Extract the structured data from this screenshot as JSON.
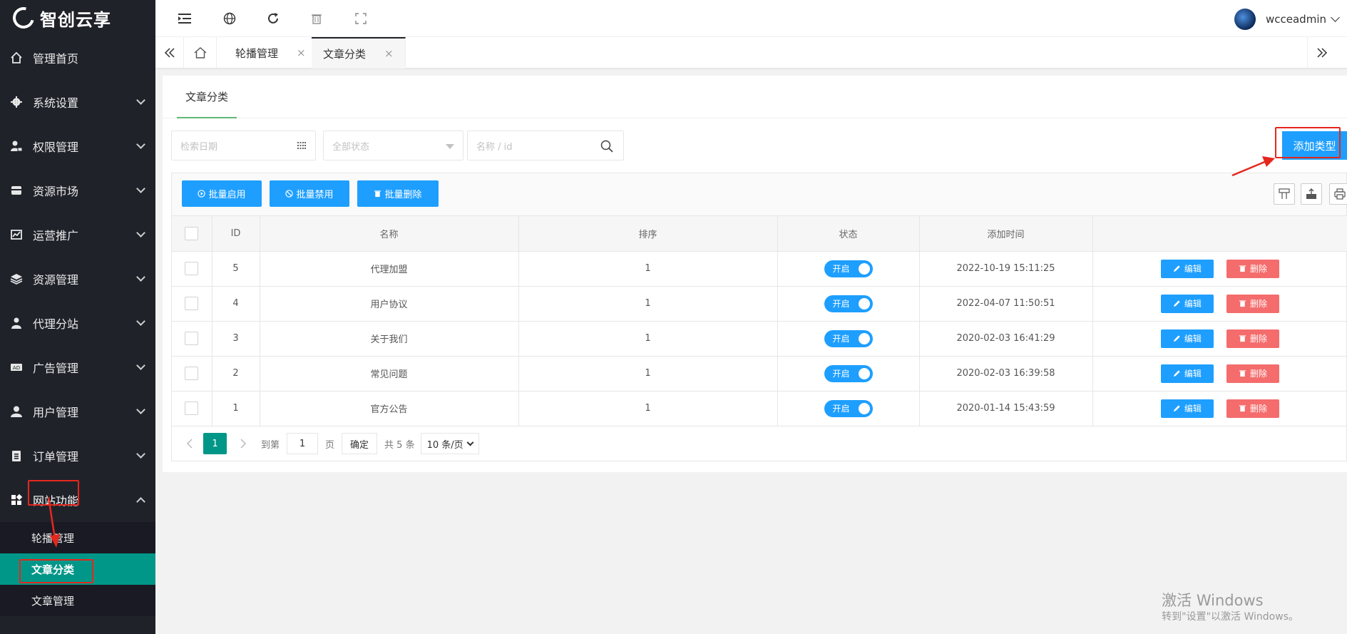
{
  "app": {
    "logo_text": "智创云享"
  },
  "sidebar": {
    "items": [
      {
        "label": "管理首页",
        "icon": "home-icon"
      },
      {
        "label": "系统设置",
        "icon": "gear-icon"
      },
      {
        "label": "权限管理",
        "icon": "lock-user-icon"
      },
      {
        "label": "资源市场",
        "icon": "store-icon"
      },
      {
        "label": "运营推广",
        "icon": "chart-icon"
      },
      {
        "label": "资源管理",
        "icon": "layers-icon"
      },
      {
        "label": "代理分站",
        "icon": "agent-icon"
      },
      {
        "label": "广告管理",
        "icon": "ad-icon"
      },
      {
        "label": "用户管理",
        "icon": "user-icon"
      },
      {
        "label": "订单管理",
        "icon": "clipboard-icon"
      },
      {
        "label": "网站功能",
        "icon": "grid-icon"
      }
    ],
    "submenu": [
      {
        "label": "轮播管理"
      },
      {
        "label": "文章分类",
        "active": true
      },
      {
        "label": "文章管理"
      }
    ]
  },
  "header": {
    "username": "wcceadmin"
  },
  "tabs": [
    {
      "label": "轮播管理",
      "close": "×"
    },
    {
      "label": "文章分类",
      "close": "×",
      "active": true
    }
  ],
  "panel": {
    "tab_label": "文章分类",
    "filters": {
      "date_placeholder": "检索日期",
      "status_placeholder": "全部状态",
      "search_placeholder": "名称 / id"
    },
    "add_button": "添加类型",
    "toolbar": {
      "batch_enable": "批量启用",
      "batch_disable": "批量禁用",
      "batch_delete": "批量删除"
    },
    "table": {
      "headers": [
        "ID",
        "名称",
        "排序",
        "状态",
        "添加时间",
        ""
      ],
      "rows": [
        {
          "id": "5",
          "name": "代理加盟",
          "sort": "1",
          "status": "开启",
          "time": "2022-10-19 15:11:25"
        },
        {
          "id": "4",
          "name": "用户协议",
          "sort": "1",
          "status": "开启",
          "time": "2022-04-07 11:50:51"
        },
        {
          "id": "3",
          "name": "关于我们",
          "sort": "1",
          "status": "开启",
          "time": "2020-02-03 16:41:29"
        },
        {
          "id": "2",
          "name": "常见问题",
          "sort": "1",
          "status": "开启",
          "time": "2020-02-03 16:39:58"
        },
        {
          "id": "1",
          "name": "官方公告",
          "sort": "1",
          "status": "开启",
          "time": "2020-01-14 15:43:59"
        }
      ],
      "edit_label": "编辑",
      "delete_label": "删除"
    },
    "pager": {
      "current": "1",
      "goto_label": "到第",
      "goto_value": "1",
      "page_unit": "页",
      "confirm": "确定",
      "total": "共 5 条",
      "page_size": "10 条/页"
    }
  },
  "watermark": {
    "title": "激活 Windows",
    "subtitle": "转到\"设置\"以激活 Windows。"
  },
  "colors": {
    "sidebar_bg": "#20222a",
    "active_teal": "#009688",
    "primary_blue": "#1e9fff",
    "danger_red": "#f56c6c",
    "annotation_red": "#e5271d"
  }
}
